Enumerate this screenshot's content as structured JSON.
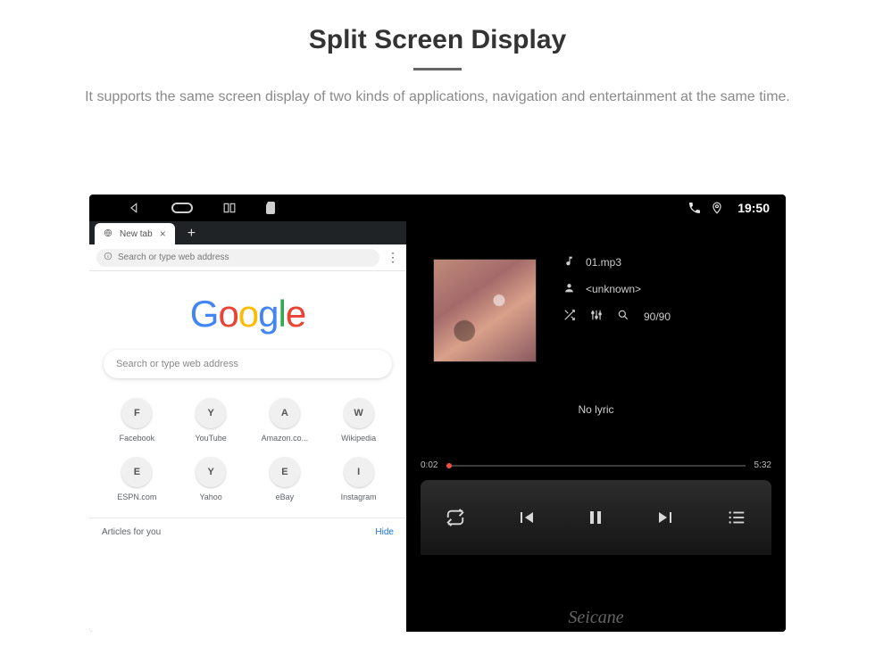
{
  "page": {
    "title": "Split Screen Display",
    "subtitle": "It supports the same screen display of two kinds of applications, navigation and entertainment at the same time."
  },
  "statusbar": {
    "time": "19:50"
  },
  "browser": {
    "tab_label": "New tab",
    "omnibox_placeholder": "Search or type web address",
    "search_placeholder": "Search or type web address",
    "shortcuts": [
      {
        "letter": "F",
        "label": "Facebook"
      },
      {
        "letter": "Y",
        "label": "YouTube"
      },
      {
        "letter": "A",
        "label": "Amazon.co..."
      },
      {
        "letter": "W",
        "label": "Wikipedia"
      },
      {
        "letter": "E",
        "label": "ESPN.com"
      },
      {
        "letter": "Y",
        "label": "Yahoo"
      },
      {
        "letter": "E",
        "label": "eBay"
      },
      {
        "letter": "I",
        "label": "Instagram"
      }
    ],
    "articles_label": "Articles for you",
    "articles_hide": "Hide"
  },
  "player": {
    "track_name": "01.mp3",
    "artist": "<unknown>",
    "count": "90/90",
    "no_lyric": "No lyric",
    "time_current": "0:02",
    "time_total": "5:32"
  },
  "watermark": "Seicane"
}
